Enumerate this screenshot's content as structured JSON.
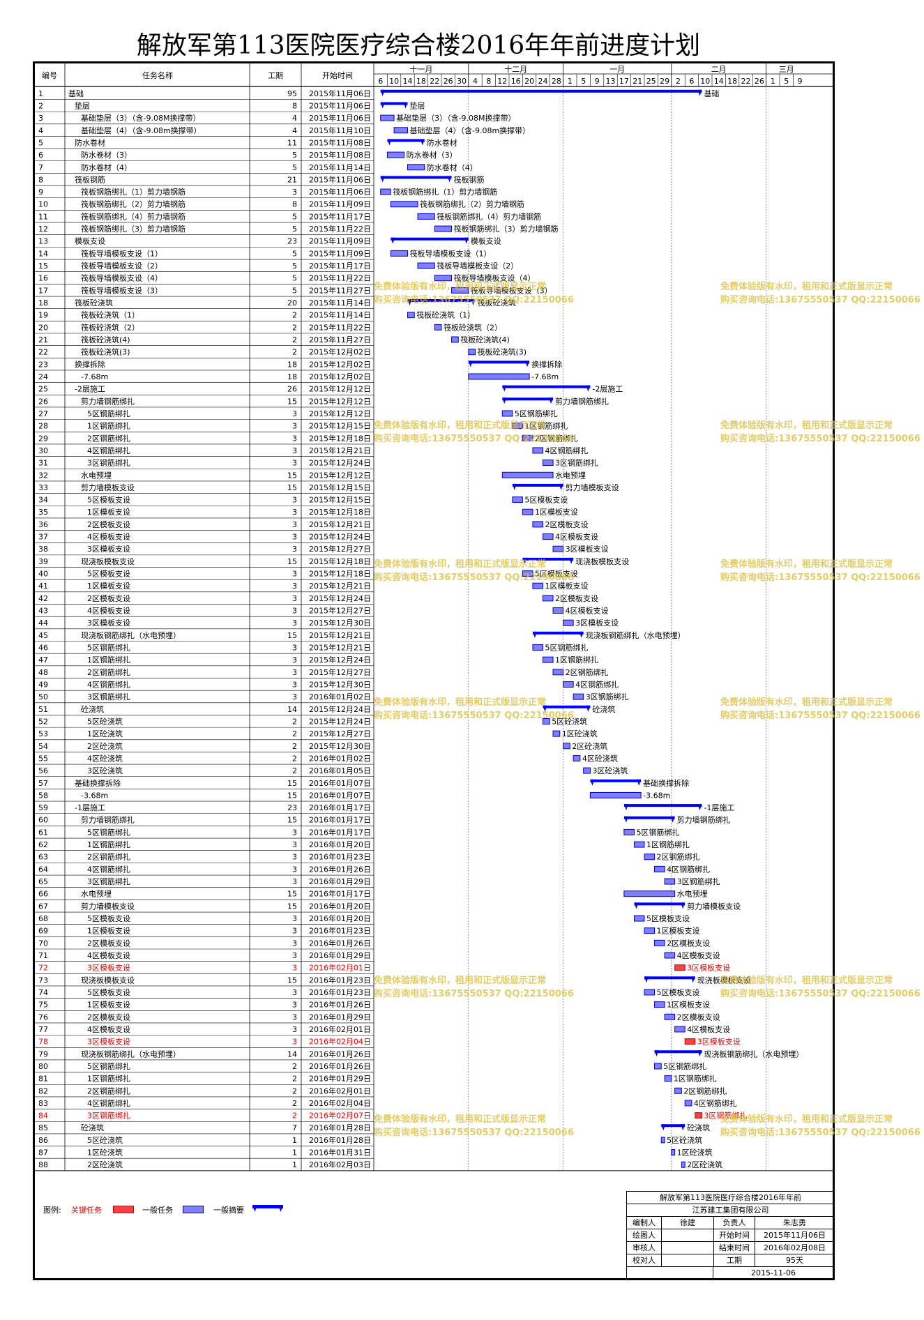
{
  "title": "解放军第113医院医疗综合楼2016年年前进度计划",
  "header": {
    "id": "编号",
    "name": "任务名称",
    "duration": "工期",
    "start": "开始时间"
  },
  "months": [
    "十一月",
    "十二月",
    "一月",
    "二月",
    "三月"
  ],
  "day_labels": [
    "6",
    "10",
    "14",
    "18",
    "22",
    "26",
    "30",
    "4",
    "8",
    "12",
    "16",
    "20",
    "24",
    "28",
    "1",
    "5",
    "9",
    "13",
    "17",
    "21",
    "25",
    "29",
    "2",
    "6",
    "10",
    "14",
    "18",
    "22",
    "26",
    "1",
    "5",
    "9"
  ],
  "colors": {
    "normal_fill": "#8080ff",
    "normal_border": "#0000cc",
    "summary": "#0000ff",
    "critical_fill": "#ff4040",
    "critical_text": "#e00000",
    "watermark": "#dcbe3c"
  },
  "tasks": [
    {
      "id": "1",
      "name": "基础",
      "dur": "95",
      "start": "2015年11月06日",
      "level": 0,
      "summary": true
    },
    {
      "id": "2",
      "name": "垫层",
      "dur": "8",
      "start": "2015年11月06日",
      "level": 1,
      "summary": true
    },
    {
      "id": "3",
      "name": "基础垫层（3）（含-9.08M换撑带）",
      "dur": "4",
      "start": "2015年11月06日",
      "level": 2
    },
    {
      "id": "4",
      "name": "基础垫层（4）（含-9.08m换撑带）",
      "dur": "4",
      "start": "2015年11月10日",
      "level": 2
    },
    {
      "id": "5",
      "name": "防水卷材",
      "dur": "11",
      "start": "2015年11月08日",
      "level": 1,
      "summary": true
    },
    {
      "id": "6",
      "name": "防水卷材（3）",
      "dur": "5",
      "start": "2015年11月08日",
      "level": 2
    },
    {
      "id": "7",
      "name": "防水卷材（4）",
      "dur": "5",
      "start": "2015年11月14日",
      "level": 2
    },
    {
      "id": "8",
      "name": "筏板钢筋",
      "dur": "21",
      "start": "2015年11月06日",
      "level": 1,
      "summary": true
    },
    {
      "id": "9",
      "name": "筏板钢筋绑扎（1）剪力墙钢筋",
      "dur": "3",
      "start": "2015年11月06日",
      "level": 2
    },
    {
      "id": "10",
      "name": "筏板钢筋绑扎（2）剪力墙钢筋",
      "dur": "8",
      "start": "2015年11月09日",
      "level": 2
    },
    {
      "id": "11",
      "name": "筏板钢筋绑扎（4）剪力墙钢筋",
      "dur": "5",
      "start": "2015年11月17日",
      "level": 2
    },
    {
      "id": "12",
      "name": "筏板钢筋绑扎（3）剪力墙钢筋",
      "dur": "5",
      "start": "2015年11月22日",
      "level": 2
    },
    {
      "id": "13",
      "name": "模板支设",
      "dur": "23",
      "start": "2015年11月09日",
      "level": 1,
      "summary": true
    },
    {
      "id": "14",
      "name": "筏板导墙模板支设（1）",
      "dur": "5",
      "start": "2015年11月09日",
      "level": 2
    },
    {
      "id": "15",
      "name": "筏板导墙模板支设（2）",
      "dur": "5",
      "start": "2015年11月17日",
      "level": 2
    },
    {
      "id": "16",
      "name": "筏板导墙模板支设（4）",
      "dur": "5",
      "start": "2015年11月22日",
      "level": 2
    },
    {
      "id": "17",
      "name": "筏板导墙模板支设（3）",
      "dur": "5",
      "start": "2015年11月27日",
      "level": 2
    },
    {
      "id": "18",
      "name": "筏板砼浇筑",
      "dur": "20",
      "start": "2015年11月14日",
      "level": 1,
      "summary": true
    },
    {
      "id": "19",
      "name": "筏板砼浇筑（1）",
      "dur": "2",
      "start": "2015年11月14日",
      "level": 2
    },
    {
      "id": "20",
      "name": "筏板砼浇筑（2）",
      "dur": "2",
      "start": "2015年11月22日",
      "level": 2
    },
    {
      "id": "21",
      "name": "筏板砼浇筑(4)",
      "dur": "2",
      "start": "2015年11月27日",
      "level": 2
    },
    {
      "id": "22",
      "name": "筏板砼浇筑(3)",
      "dur": "2",
      "start": "2015年12月02日",
      "level": 2
    },
    {
      "id": "23",
      "name": "换撑拆除",
      "dur": "18",
      "start": "2015年12月02日",
      "level": 1,
      "summary": true
    },
    {
      "id": "24",
      "name": "-7.68m",
      "dur": "18",
      "start": "2015年12月02日",
      "level": 2
    },
    {
      "id": "25",
      "name": "-2层施工",
      "dur": "26",
      "start": "2015年12月12日",
      "level": 1,
      "summary": true
    },
    {
      "id": "26",
      "name": "剪力墙钢筋绑扎",
      "dur": "15",
      "start": "2015年12月12日",
      "level": 2,
      "summary": true
    },
    {
      "id": "27",
      "name": "5区钢筋绑扎",
      "dur": "3",
      "start": "2015年12月12日",
      "level": 3
    },
    {
      "id": "28",
      "name": "1区钢筋绑扎",
      "dur": "3",
      "start": "2015年12月15日",
      "level": 3
    },
    {
      "id": "29",
      "name": "2区钢筋绑扎",
      "dur": "3",
      "start": "2015年12月18日",
      "level": 3
    },
    {
      "id": "30",
      "name": "4区钢筋绑扎",
      "dur": "3",
      "start": "2015年12月21日",
      "level": 3
    },
    {
      "id": "31",
      "name": "3区钢筋绑扎",
      "dur": "3",
      "start": "2015年12月24日",
      "level": 3
    },
    {
      "id": "32",
      "name": "水电预埋",
      "dur": "15",
      "start": "2015年12月12日",
      "level": 2
    },
    {
      "id": "33",
      "name": "剪力墙模板支设",
      "dur": "15",
      "start": "2015年12月15日",
      "level": 2,
      "summary": true
    },
    {
      "id": "34",
      "name": "5区模板支设",
      "dur": "3",
      "start": "2015年12月15日",
      "level": 3
    },
    {
      "id": "35",
      "name": "1区模板支设",
      "dur": "3",
      "start": "2015年12月18日",
      "level": 3
    },
    {
      "id": "36",
      "name": "2区模板支设",
      "dur": "3",
      "start": "2015年12月21日",
      "level": 3
    },
    {
      "id": "37",
      "name": "4区模板支设",
      "dur": "3",
      "start": "2015年12月24日",
      "level": 3
    },
    {
      "id": "38",
      "name": "3区模板支设",
      "dur": "3",
      "start": "2015年12月27日",
      "level": 3
    },
    {
      "id": "39",
      "name": "现浇板模板支设",
      "dur": "15",
      "start": "2015年12月18日",
      "level": 2,
      "summary": true
    },
    {
      "id": "40",
      "name": "5区模板支设",
      "dur": "3",
      "start": "2015年12月18日",
      "level": 3
    },
    {
      "id": "41",
      "name": "1区模板支设",
      "dur": "3",
      "start": "2015年12月21日",
      "level": 3
    },
    {
      "id": "42",
      "name": "2区模板支设",
      "dur": "3",
      "start": "2015年12月24日",
      "level": 3
    },
    {
      "id": "43",
      "name": "4区模板支设",
      "dur": "3",
      "start": "2015年12月27日",
      "level": 3
    },
    {
      "id": "44",
      "name": "3区模板支设",
      "dur": "3",
      "start": "2015年12月30日",
      "level": 3
    },
    {
      "id": "45",
      "name": "现浇板钢筋绑扎（水电预埋）",
      "dur": "15",
      "start": "2015年12月21日",
      "level": 2,
      "summary": true
    },
    {
      "id": "46",
      "name": "5区钢筋绑扎",
      "dur": "3",
      "start": "2015年12月21日",
      "level": 3
    },
    {
      "id": "47",
      "name": "1区钢筋绑扎",
      "dur": "3",
      "start": "2015年12月24日",
      "level": 3
    },
    {
      "id": "48",
      "name": "2区钢筋绑扎",
      "dur": "3",
      "start": "2015年12月27日",
      "level": 3
    },
    {
      "id": "49",
      "name": "4区钢筋绑扎",
      "dur": "3",
      "start": "2015年12月30日",
      "level": 3
    },
    {
      "id": "50",
      "name": "3区钢筋绑扎",
      "dur": "3",
      "start": "2016年01月02日",
      "level": 3
    },
    {
      "id": "51",
      "name": "砼浇筑",
      "dur": "14",
      "start": "2015年12月24日",
      "level": 2,
      "summary": true
    },
    {
      "id": "52",
      "name": "5区砼浇筑",
      "dur": "2",
      "start": "2015年12月24日",
      "level": 3
    },
    {
      "id": "53",
      "name": "1区砼浇筑",
      "dur": "2",
      "start": "2015年12月27日",
      "level": 3
    },
    {
      "id": "54",
      "name": "2区砼浇筑",
      "dur": "2",
      "start": "2015年12月30日",
      "level": 3
    },
    {
      "id": "55",
      "name": "4区砼浇筑",
      "dur": "2",
      "start": "2016年01月02日",
      "level": 3
    },
    {
      "id": "56",
      "name": "3区砼浇筑",
      "dur": "2",
      "start": "2016年01月05日",
      "level": 3
    },
    {
      "id": "57",
      "name": "基础换撑拆除",
      "dur": "15",
      "start": "2016年01月07日",
      "level": 1,
      "summary": true
    },
    {
      "id": "58",
      "name": "-3.68m",
      "dur": "15",
      "start": "2016年01月07日",
      "level": 2
    },
    {
      "id": "59",
      "name": "-1层施工",
      "dur": "23",
      "start": "2016年01月17日",
      "level": 1,
      "summary": true
    },
    {
      "id": "60",
      "name": "剪力墙钢筋绑扎",
      "dur": "15",
      "start": "2016年01月17日",
      "level": 2,
      "summary": true
    },
    {
      "id": "61",
      "name": "5区钢筋绑扎",
      "dur": "3",
      "start": "2016年01月17日",
      "level": 3
    },
    {
      "id": "62",
      "name": "1区钢筋绑扎",
      "dur": "3",
      "start": "2016年01月20日",
      "level": 3
    },
    {
      "id": "63",
      "name": "2区钢筋绑扎",
      "dur": "3",
      "start": "2016年01月23日",
      "level": 3
    },
    {
      "id": "64",
      "name": "4区钢筋绑扎",
      "dur": "3",
      "start": "2016年01月26日",
      "level": 3
    },
    {
      "id": "65",
      "name": "3区钢筋绑扎",
      "dur": "3",
      "start": "2016年01月29日",
      "level": 3
    },
    {
      "id": "66",
      "name": "水电预埋",
      "dur": "15",
      "start": "2016年01月17日",
      "level": 2
    },
    {
      "id": "67",
      "name": "剪力墙模板支设",
      "dur": "15",
      "start": "2016年01月20日",
      "level": 2,
      "summary": true
    },
    {
      "id": "68",
      "name": "5区模板支设",
      "dur": "3",
      "start": "2016年01月20日",
      "level": 3
    },
    {
      "id": "69",
      "name": "1区模板支设",
      "dur": "3",
      "start": "2016年01月23日",
      "level": 3
    },
    {
      "id": "70",
      "name": "2区模板支设",
      "dur": "3",
      "start": "2016年01月26日",
      "level": 3
    },
    {
      "id": "71",
      "name": "4区模板支设",
      "dur": "3",
      "start": "2016年01月29日",
      "level": 3
    },
    {
      "id": "72",
      "name": "3区模板支设",
      "dur": "3",
      "start": "2016年02月01日",
      "level": 3,
      "critical": true
    },
    {
      "id": "73",
      "name": "现浇板模板支设",
      "dur": "15",
      "start": "2016年01月23日",
      "level": 2,
      "summary": true
    },
    {
      "id": "74",
      "name": "5区模板支设",
      "dur": "3",
      "start": "2016年01月23日",
      "level": 3
    },
    {
      "id": "75",
      "name": "1区模板支设",
      "dur": "3",
      "start": "2016年01月26日",
      "level": 3
    },
    {
      "id": "76",
      "name": "2区模板支设",
      "dur": "3",
      "start": "2016年01月29日",
      "level": 3
    },
    {
      "id": "77",
      "name": "4区模板支设",
      "dur": "3",
      "start": "2016年02月01日",
      "level": 3
    },
    {
      "id": "78",
      "name": "3区模板支设",
      "dur": "3",
      "start": "2016年02月04日",
      "level": 3,
      "critical": true
    },
    {
      "id": "79",
      "name": "现浇板钢筋绑扎（水电预埋）",
      "dur": "14",
      "start": "2016年01月26日",
      "level": 2,
      "summary": true
    },
    {
      "id": "80",
      "name": "5区钢筋绑扎",
      "dur": "2",
      "start": "2016年01月26日",
      "level": 3
    },
    {
      "id": "81",
      "name": "1区钢筋绑扎",
      "dur": "2",
      "start": "2016年01月29日",
      "level": 3
    },
    {
      "id": "82",
      "name": "2区钢筋绑扎",
      "dur": "2",
      "start": "2016年02月01日",
      "level": 3
    },
    {
      "id": "83",
      "name": "4区钢筋绑扎",
      "dur": "2",
      "start": "2016年02月04日",
      "level": 3
    },
    {
      "id": "84",
      "name": "3区钢筋绑扎",
      "dur": "2",
      "start": "2016年02月07日",
      "level": 3,
      "critical": true
    },
    {
      "id": "85",
      "name": "砼浇筑",
      "dur": "7",
      "start": "2016年01月28日",
      "level": 2,
      "summary": true
    },
    {
      "id": "86",
      "name": "5区砼浇筑",
      "dur": "1",
      "start": "2016年01月28日",
      "level": 3
    },
    {
      "id": "87",
      "name": "1区砼浇筑",
      "dur": "1",
      "start": "2016年01月31日",
      "level": 3
    },
    {
      "id": "88",
      "name": "2区砼浇筑",
      "dur": "1",
      "start": "2016年02月03日",
      "level": 3
    }
  ],
  "watermark": {
    "line1": "免费体验版有水印，租用和正式版显示正常",
    "line2": "购买咨询电话:13675550537 QQ:22150066"
  },
  "legend": {
    "label": "图例:",
    "critical": "关键任务",
    "normal": "一般任务",
    "summary": "一般摘要"
  },
  "info": {
    "project": "解放军第113医院医疗综合楼2016年年前",
    "company": "江苏建工集团有限公司",
    "editor_label": "编制人",
    "editor": "徐建",
    "manager_label": "负责人",
    "manager": "朱志勇",
    "drawer_label": "绘图人",
    "start_label": "开始时间",
    "start": "2015年11月06日",
    "reviewer_label": "审核人",
    "end_label": "结束时间",
    "end": "2016年02月08日",
    "checker_label": "校对人",
    "duration_label": "工期",
    "duration": "95天",
    "date": "2015-11-06"
  }
}
